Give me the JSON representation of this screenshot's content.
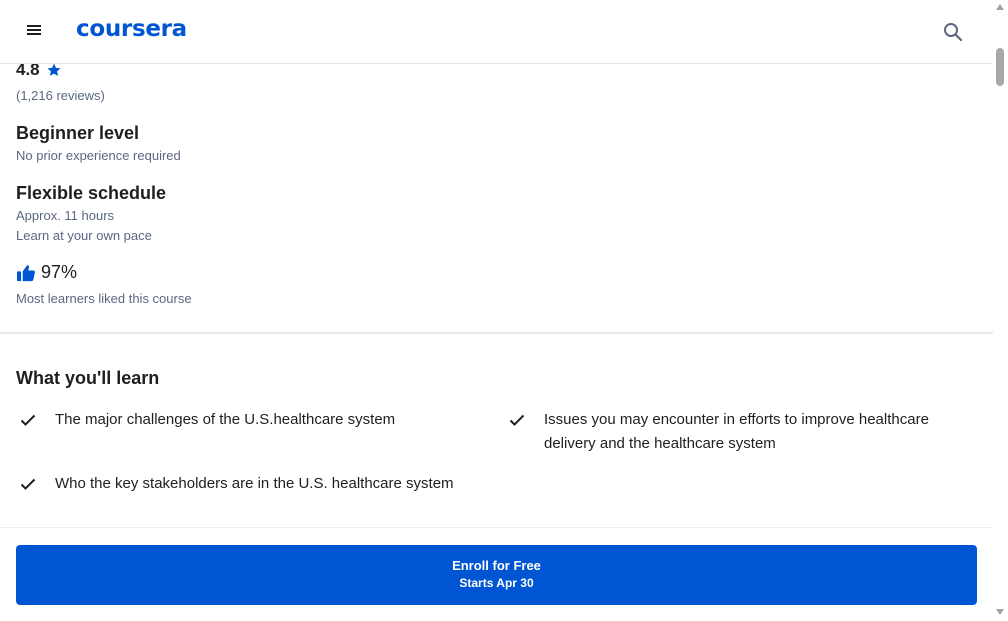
{
  "header": {
    "logo_text": "coursera",
    "menu_icon": "hamburger-menu-icon",
    "search_icon": "search-icon"
  },
  "course": {
    "rating": "4.8",
    "reviews": "(1,216 reviews)",
    "level": {
      "title": "Beginner level",
      "subtitle": "No prior experience required"
    },
    "schedule": {
      "title": "Flexible schedule",
      "duration": "Approx. 11 hours",
      "pace": "Learn at your own pace"
    },
    "liked": {
      "percent": "97%",
      "subtitle": "Most learners liked this course"
    }
  },
  "learn": {
    "title": "What you'll learn",
    "items": [
      "The major challenges of the U.S.healthcare system",
      "Issues you may encounter in efforts to improve healthcare delivery and the healthcare system",
      "Who the key stakeholders are in the U.S. healthcare system"
    ]
  },
  "enroll": {
    "label": "Enroll for Free",
    "starts": "Starts Apr 30"
  },
  "colors": {
    "brand": "#0056d2",
    "text": "#1f1f1f",
    "muted": "#5b6780"
  }
}
